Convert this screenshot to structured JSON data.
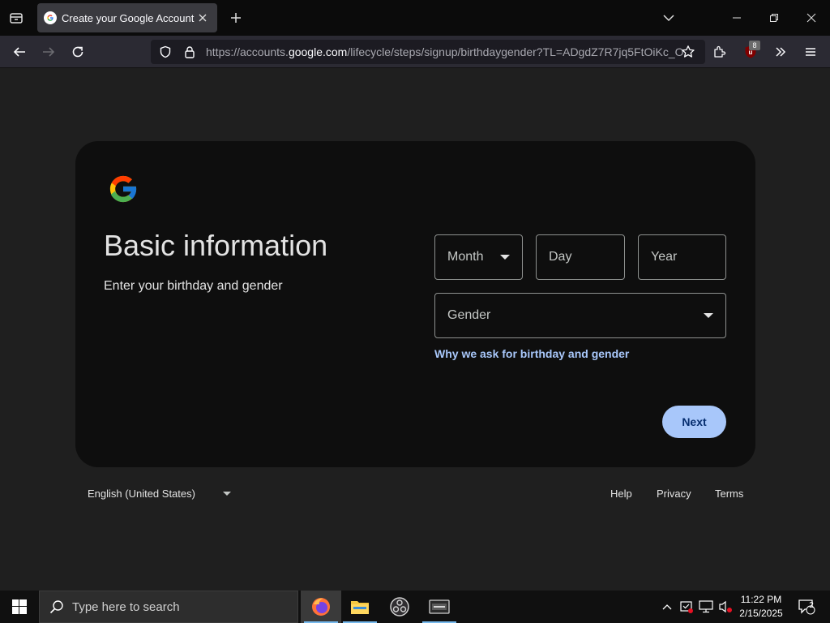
{
  "browser": {
    "tab": {
      "title": "Create your Google Account"
    },
    "url": {
      "prefix": "https://accounts.",
      "domain": "google.com",
      "path": "/lifecycle/steps/signup/birthdaygender?TL=ADgdZ7R7jq5FtOiKc_O"
    },
    "extension_badge": "8"
  },
  "page": {
    "title": "Basic information",
    "subtitle": "Enter your birthday and gender",
    "month_placeholder": "Month",
    "day_placeholder": "Day",
    "year_placeholder": "Year",
    "gender_placeholder": "Gender",
    "why_link": "Why we ask for birthday and gender",
    "next_label": "Next"
  },
  "footer": {
    "language": "English (United States)",
    "help": "Help",
    "privacy": "Privacy",
    "terms": "Terms"
  },
  "taskbar": {
    "search_placeholder": "Type here to search",
    "time": "11:22 PM",
    "date": "2/15/2025",
    "notification_count": "2"
  },
  "colors": {
    "accent": "#a8c7fa",
    "next_text": "#062e6f",
    "card_bg": "#0e0e0e",
    "page_bg": "#1f1f1f"
  }
}
